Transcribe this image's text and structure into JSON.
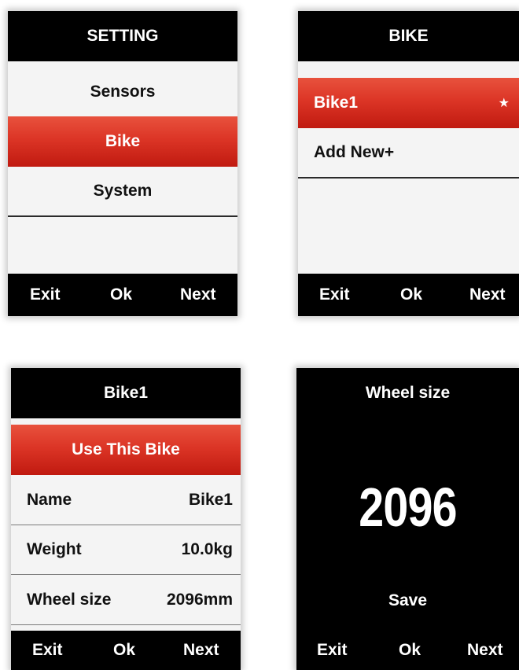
{
  "screens": {
    "setting": {
      "title": "SETTING",
      "items": [
        "Sensors",
        "Bike",
        "System"
      ],
      "footer": {
        "exit": "Exit",
        "ok": "Ok",
        "next": "Next"
      }
    },
    "bike": {
      "title": "BIKE",
      "items": [
        {
          "label": "Bike1",
          "icon": "star-icon",
          "icon_glyph": "★"
        },
        {
          "label": "Add New+"
        }
      ],
      "footer": {
        "exit": "Exit",
        "ok": "Ok",
        "next": "Next"
      }
    },
    "bike1": {
      "title": "Bike1",
      "action": "Use This Bike",
      "fields": [
        {
          "label": "Name",
          "value": "Bike1"
        },
        {
          "label": "Weight",
          "value": "10.0kg"
        },
        {
          "label": "Wheel size",
          "value": "2096mm"
        }
      ],
      "footer": {
        "exit": "Exit",
        "ok": "Ok",
        "next": "Next"
      }
    },
    "wheel_size": {
      "title": "Wheel size",
      "value": "2096",
      "save": "Save",
      "footer": {
        "exit": "Exit",
        "ok": "Ok",
        "next": "Next"
      }
    }
  },
  "colors": {
    "highlight": "#d42d1f",
    "header": "#000000",
    "list_background": "#f4f4f4"
  }
}
